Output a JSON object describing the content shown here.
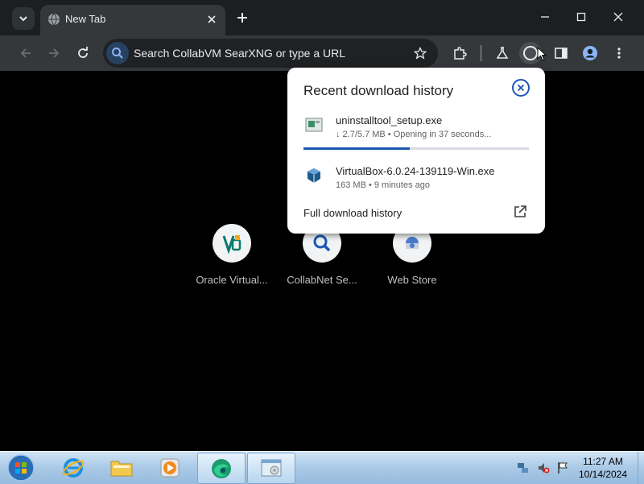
{
  "browser": {
    "tab": {
      "title": "New Tab"
    },
    "omnibox": {
      "placeholder": "Search CollabVM SearXNG or type a URL"
    }
  },
  "shortcuts": [
    {
      "label": "Oracle Virtual...",
      "icon": "virtualbox-icon"
    },
    {
      "label": "CollabNet Se...",
      "icon": "search-icon"
    },
    {
      "label": "Web Store",
      "icon": "web-store-icon"
    }
  ],
  "download_bubble": {
    "title": "Recent download history",
    "items": [
      {
        "name": "uninstalltool_setup.exe",
        "status": "↓ 2.7/5.7 MB • Opening in 37 seconds...",
        "progress": 0.47
      },
      {
        "name": "VirtualBox-6.0.24-139119-Win.exe",
        "status": "163 MB • 9 minutes ago"
      }
    ],
    "full_history_label": "Full download history"
  },
  "taskbar": {
    "clock_time": "11:27 AM",
    "clock_date": "10/14/2024"
  },
  "colors": {
    "accent": "#1a56b3",
    "toolbar": "#35383b",
    "titlebar": "#1b1f22"
  }
}
